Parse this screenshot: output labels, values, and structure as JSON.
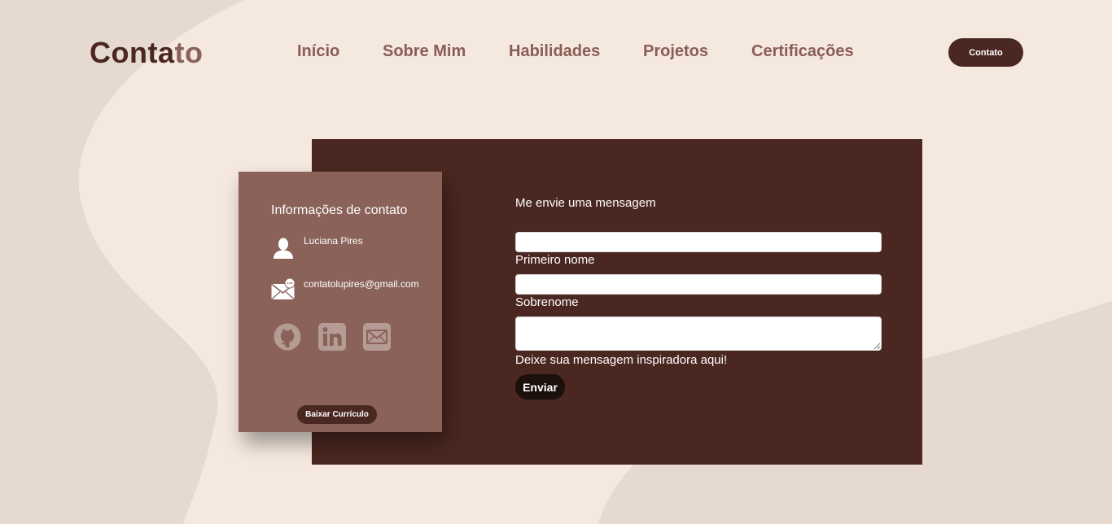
{
  "logo": {
    "text_main": "Conta",
    "text_accent": "to"
  },
  "nav": {
    "items": [
      {
        "label": "Início"
      },
      {
        "label": "Sobre Mim"
      },
      {
        "label": "Habilidades"
      },
      {
        "label": "Projetos"
      },
      {
        "label": "Certificações"
      }
    ],
    "contact_button": "Contato"
  },
  "info_card": {
    "title": "Informações de contato",
    "name": "Luciana Pires",
    "name_icon": "person-icon",
    "email": "contatolupires@gmail.com",
    "email_icon": "envelope-icon",
    "social": [
      "github-icon",
      "linkedin-icon",
      "mail-icon"
    ],
    "download_button": "Baixar Currículo"
  },
  "form": {
    "title": "Me envie uma mensagem",
    "first_name": {
      "value": "",
      "label": "Primeiro nome"
    },
    "last_name": {
      "value": "",
      "label": "Sobrenome"
    },
    "message": {
      "value": "",
      "label": "Deixe sua mensagem inspiradora aqui!"
    },
    "submit": "Enviar"
  },
  "colors": {
    "background": "#e6d9cf",
    "background_light": "#f4e8df",
    "brown_dark": "#4a2720",
    "brown_card": "#8a6259",
    "nav_text": "#8a5d55",
    "button_dark": "#1c100d"
  }
}
